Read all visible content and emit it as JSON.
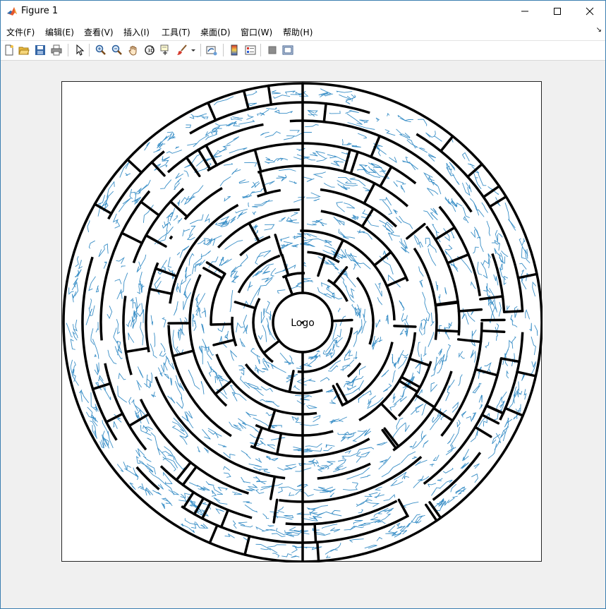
{
  "window": {
    "title": "Figure 1",
    "app_icon": "matlab-icon"
  },
  "menubar": {
    "items": [
      {
        "label": "文件(F)"
      },
      {
        "label": "编辑(E)"
      },
      {
        "label": "查看(V)"
      },
      {
        "label": "插入(I)"
      },
      {
        "label": "工具(T)"
      },
      {
        "label": "桌面(D)"
      },
      {
        "label": "窗口(W)"
      },
      {
        "label": "帮助(H)"
      }
    ]
  },
  "toolbar": {
    "buttons": [
      "new-figure-icon",
      "open-file-icon",
      "save-icon",
      "print-icon",
      "select-arrow-icon",
      "zoom-in-icon",
      "zoom-out-icon",
      "pan-hand-icon",
      "rotate-3d-icon",
      "data-cursor-icon",
      "brush-icon",
      "link-plot-icon",
      "colorbar-icon",
      "legend-icon",
      "hide-plot-tools-icon",
      "show-plot-tools-icon"
    ]
  },
  "figure": {
    "center_label": "Logo",
    "colors": {
      "wall": "#000000",
      "path": "#3a8fc7",
      "axes_border": "#262626"
    }
  }
}
